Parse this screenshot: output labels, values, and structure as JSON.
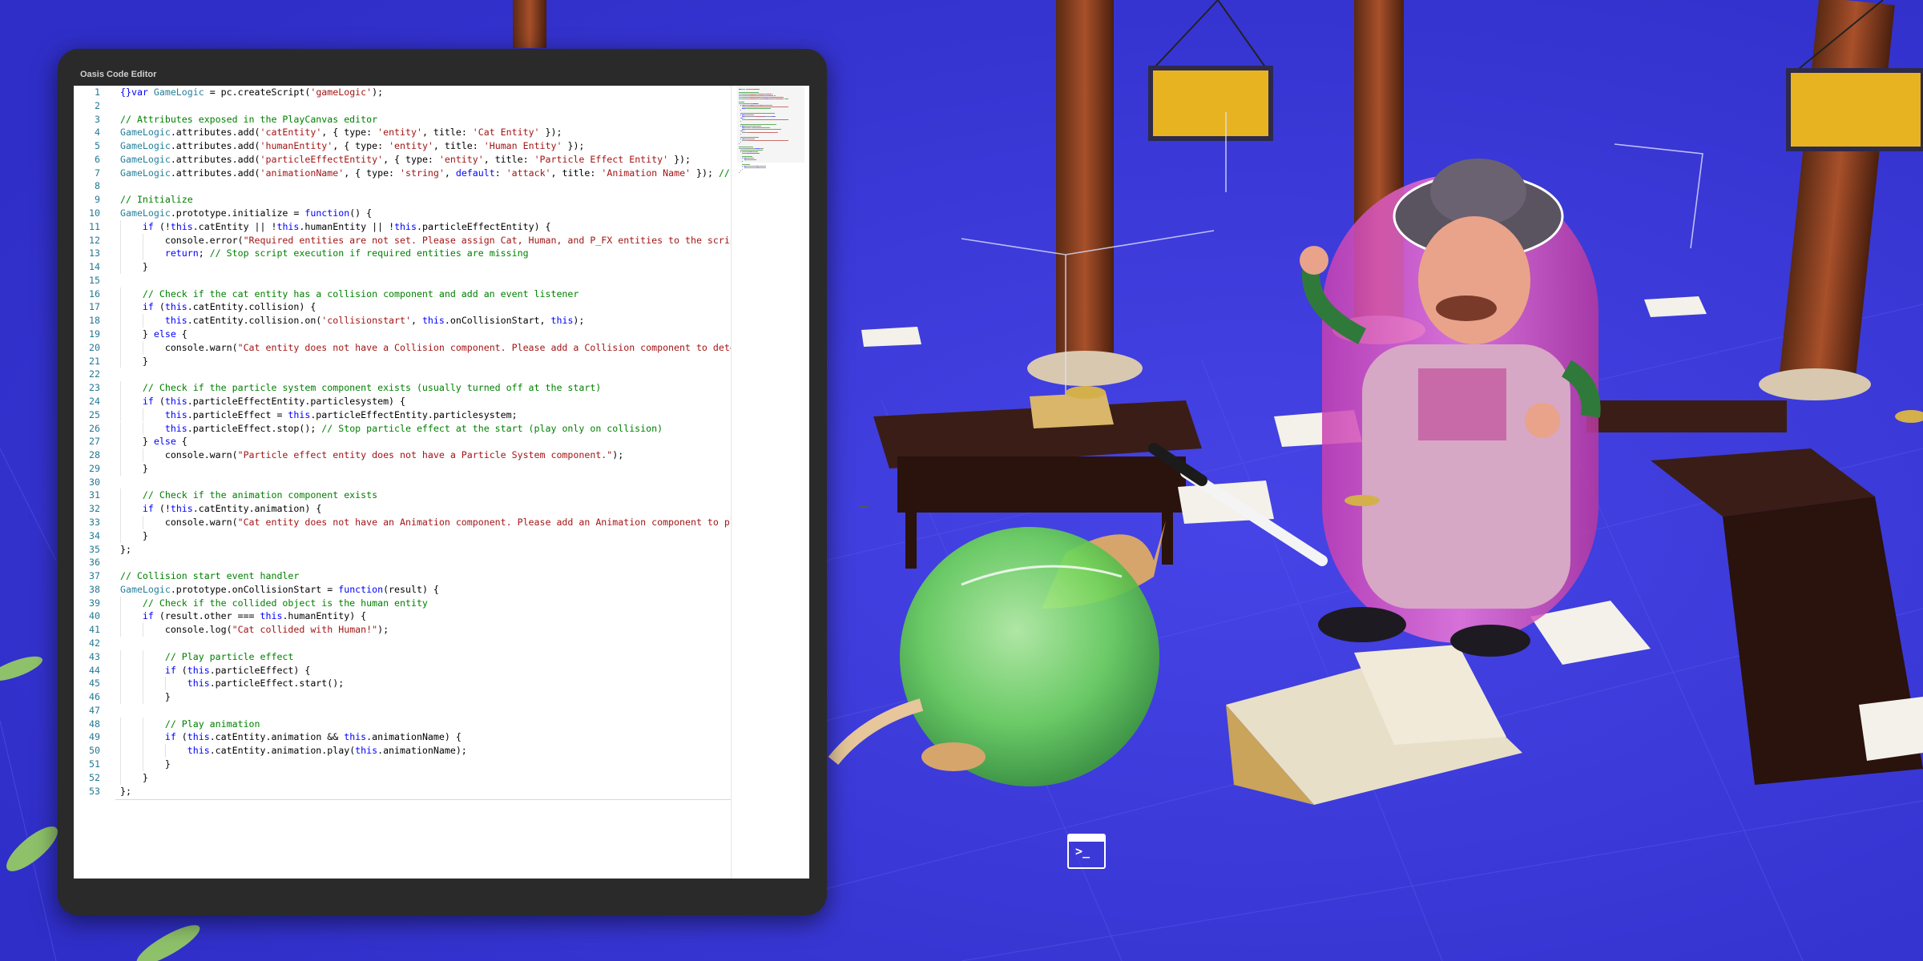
{
  "editor": {
    "title": "Oasis Code Editor",
    "code_lines": [
      [
        [
          "kw",
          "{}"
        ],
        [
          "kw",
          "var "
        ],
        [
          "type",
          "GameLogic"
        ],
        [
          "txt",
          " = pc.createScript("
        ],
        [
          "str",
          "'gameLogic'"
        ],
        [
          "txt",
          ");"
        ]
      ],
      [],
      [
        [
          "com",
          "// Attributes exposed in the PlayCanvas editor"
        ]
      ],
      [
        [
          "type",
          "GameLogic"
        ],
        [
          "txt",
          ".attributes.add("
        ],
        [
          "str",
          "'catEntity'"
        ],
        [
          "txt",
          ", { type: "
        ],
        [
          "str",
          "'entity'"
        ],
        [
          "txt",
          ", title: "
        ],
        [
          "str",
          "'Cat Entity'"
        ],
        [
          "txt",
          " });"
        ]
      ],
      [
        [
          "type",
          "GameLogic"
        ],
        [
          "txt",
          ".attributes.add("
        ],
        [
          "str",
          "'humanEntity'"
        ],
        [
          "txt",
          ", { type: "
        ],
        [
          "str",
          "'entity'"
        ],
        [
          "txt",
          ", title: "
        ],
        [
          "str",
          "'Human Entity'"
        ],
        [
          "txt",
          " });"
        ]
      ],
      [
        [
          "type",
          "GameLogic"
        ],
        [
          "txt",
          ".attributes.add("
        ],
        [
          "str",
          "'particleEffectEntity'"
        ],
        [
          "txt",
          ", { type: "
        ],
        [
          "str",
          "'entity'"
        ],
        [
          "txt",
          ", title: "
        ],
        [
          "str",
          "'Particle Effect Entity'"
        ],
        [
          "txt",
          " });"
        ]
      ],
      [
        [
          "type",
          "GameLogic"
        ],
        [
          "txt",
          ".attributes.add("
        ],
        [
          "str",
          "'animationName'"
        ],
        [
          "txt",
          ", { type: "
        ],
        [
          "str",
          "'string'"
        ],
        [
          "txt",
          ", "
        ],
        [
          "kw",
          "default"
        ],
        [
          "txt",
          ": "
        ],
        [
          "str",
          "'attack'"
        ],
        [
          "txt",
          ", title: "
        ],
        [
          "str",
          "'Animation Name'"
        ],
        [
          "txt",
          " }); "
        ],
        [
          "com",
          "// De"
        ]
      ],
      [],
      [
        [
          "com",
          "// Initialize"
        ]
      ],
      [
        [
          "type",
          "GameLogic"
        ],
        [
          "txt",
          ".prototype.initialize = "
        ],
        [
          "kw",
          "function"
        ],
        [
          "txt",
          "() {"
        ]
      ],
      [
        [
          "txt",
          "    "
        ],
        [
          "kw",
          "if"
        ],
        [
          "txt",
          " (!"
        ],
        [
          "kw",
          "this"
        ],
        [
          "txt",
          ".catEntity || !"
        ],
        [
          "kw",
          "this"
        ],
        [
          "txt",
          ".humanEntity || !"
        ],
        [
          "kw",
          "this"
        ],
        [
          "txt",
          ".particleEffectEntity) {"
        ]
      ],
      [
        [
          "txt",
          "        console.error("
        ],
        [
          "str",
          "\"Required entities are not set. Please assign Cat, Human, and P_FX entities to the script i"
        ]
      ],
      [
        [
          "txt",
          "        "
        ],
        [
          "kw",
          "return"
        ],
        [
          "txt",
          "; "
        ],
        [
          "com",
          "// Stop script execution if required entities are missing"
        ]
      ],
      [
        [
          "txt",
          "    }"
        ]
      ],
      [],
      [
        [
          "txt",
          "    "
        ],
        [
          "com",
          "// Check if the cat entity has a collision component and add an event listener"
        ]
      ],
      [
        [
          "txt",
          "    "
        ],
        [
          "kw",
          "if"
        ],
        [
          "txt",
          " ("
        ],
        [
          "kw",
          "this"
        ],
        [
          "txt",
          ".catEntity.collision) {"
        ]
      ],
      [
        [
          "txt",
          "        "
        ],
        [
          "kw",
          "this"
        ],
        [
          "txt",
          ".catEntity.collision.on("
        ],
        [
          "str",
          "'collisionstart'"
        ],
        [
          "txt",
          ", "
        ],
        [
          "kw",
          "this"
        ],
        [
          "txt",
          ".onCollisionStart, "
        ],
        [
          "kw",
          "this"
        ],
        [
          "txt",
          ");"
        ]
      ],
      [
        [
          "txt",
          "    } "
        ],
        [
          "kw",
          "else"
        ],
        [
          "txt",
          " {"
        ]
      ],
      [
        [
          "txt",
          "        console.warn("
        ],
        [
          "str",
          "\"Cat entity does not have a Collision component. Please add a Collision component to detect"
        ]
      ],
      [
        [
          "txt",
          "    }"
        ]
      ],
      [],
      [
        [
          "txt",
          "    "
        ],
        [
          "com",
          "// Check if the particle system component exists (usually turned off at the start)"
        ]
      ],
      [
        [
          "txt",
          "    "
        ],
        [
          "kw",
          "if"
        ],
        [
          "txt",
          " ("
        ],
        [
          "kw",
          "this"
        ],
        [
          "txt",
          ".particleEffectEntity.particlesystem) {"
        ]
      ],
      [
        [
          "txt",
          "        "
        ],
        [
          "kw",
          "this"
        ],
        [
          "txt",
          ".particleEffect = "
        ],
        [
          "kw",
          "this"
        ],
        [
          "txt",
          ".particleEffectEntity.particlesystem;"
        ]
      ],
      [
        [
          "txt",
          "        "
        ],
        [
          "kw",
          "this"
        ],
        [
          "txt",
          ".particleEffect.stop(); "
        ],
        [
          "com",
          "// Stop particle effect at the start (play only on collision)"
        ]
      ],
      [
        [
          "txt",
          "    } "
        ],
        [
          "kw",
          "else"
        ],
        [
          "txt",
          " {"
        ]
      ],
      [
        [
          "txt",
          "        console.warn("
        ],
        [
          "str",
          "\"Particle effect entity does not have a Particle System component.\""
        ],
        [
          "txt",
          ");"
        ]
      ],
      [
        [
          "txt",
          "    }"
        ]
      ],
      [],
      [
        [
          "txt",
          "    "
        ],
        [
          "com",
          "// Check if the animation component exists"
        ]
      ],
      [
        [
          "txt",
          "    "
        ],
        [
          "kw",
          "if"
        ],
        [
          "txt",
          " (!"
        ],
        [
          "kw",
          "this"
        ],
        [
          "txt",
          ".catEntity.animation) {"
        ]
      ],
      [
        [
          "txt",
          "        console.warn("
        ],
        [
          "str",
          "\"Cat entity does not have an Animation component. Please add an Animation component to play"
        ]
      ],
      [
        [
          "txt",
          "    }"
        ]
      ],
      [
        [
          "txt",
          "};"
        ]
      ],
      [],
      [
        [
          "com",
          "// Collision start event handler"
        ]
      ],
      [
        [
          "type",
          "GameLogic"
        ],
        [
          "txt",
          ".prototype.onCollisionStart = "
        ],
        [
          "kw",
          "function"
        ],
        [
          "txt",
          "(result) {"
        ]
      ],
      [
        [
          "txt",
          "    "
        ],
        [
          "com",
          "// Check if the collided object is the human entity"
        ]
      ],
      [
        [
          "txt",
          "    "
        ],
        [
          "kw",
          "if"
        ],
        [
          "txt",
          " (result.other === "
        ],
        [
          "kw",
          "this"
        ],
        [
          "txt",
          ".humanEntity) {"
        ]
      ],
      [
        [
          "txt",
          "        console.log("
        ],
        [
          "str",
          "\"Cat collided with Human!\""
        ],
        [
          "txt",
          ");"
        ]
      ],
      [],
      [
        [
          "txt",
          "        "
        ],
        [
          "com",
          "// Play particle effect"
        ]
      ],
      [
        [
          "txt",
          "        "
        ],
        [
          "kw",
          "if"
        ],
        [
          "txt",
          " ("
        ],
        [
          "kw",
          "this"
        ],
        [
          "txt",
          ".particleEffect) {"
        ]
      ],
      [
        [
          "txt",
          "            "
        ],
        [
          "kw",
          "this"
        ],
        [
          "txt",
          ".particleEffect.start();"
        ]
      ],
      [
        [
          "txt",
          "        }"
        ]
      ],
      [],
      [
        [
          "txt",
          "        "
        ],
        [
          "com",
          "// Play animation"
        ]
      ],
      [
        [
          "txt",
          "        "
        ],
        [
          "kw",
          "if"
        ],
        [
          "txt",
          " ("
        ],
        [
          "kw",
          "this"
        ],
        [
          "txt",
          ".catEntity.animation && "
        ],
        [
          "kw",
          "this"
        ],
        [
          "txt",
          ".animationName) {"
        ]
      ],
      [
        [
          "txt",
          "            "
        ],
        [
          "kw",
          "this"
        ],
        [
          "txt",
          ".catEntity.animation.play("
        ],
        [
          "kw",
          "this"
        ],
        [
          "txt",
          ".animationName);"
        ]
      ],
      [
        [
          "txt",
          "        }"
        ]
      ],
      [
        [
          "txt",
          "    }"
        ]
      ],
      [
        [
          "txt",
          "};"
        ]
      ]
    ]
  },
  "colors": {
    "keyword": "#0000ff",
    "string": "#a31515",
    "comment": "#008000",
    "type": "#267f99",
    "line_number": "#237893",
    "viewport_floor": "#3b3ad6"
  },
  "icons": {
    "terminal": "terminal-icon"
  }
}
